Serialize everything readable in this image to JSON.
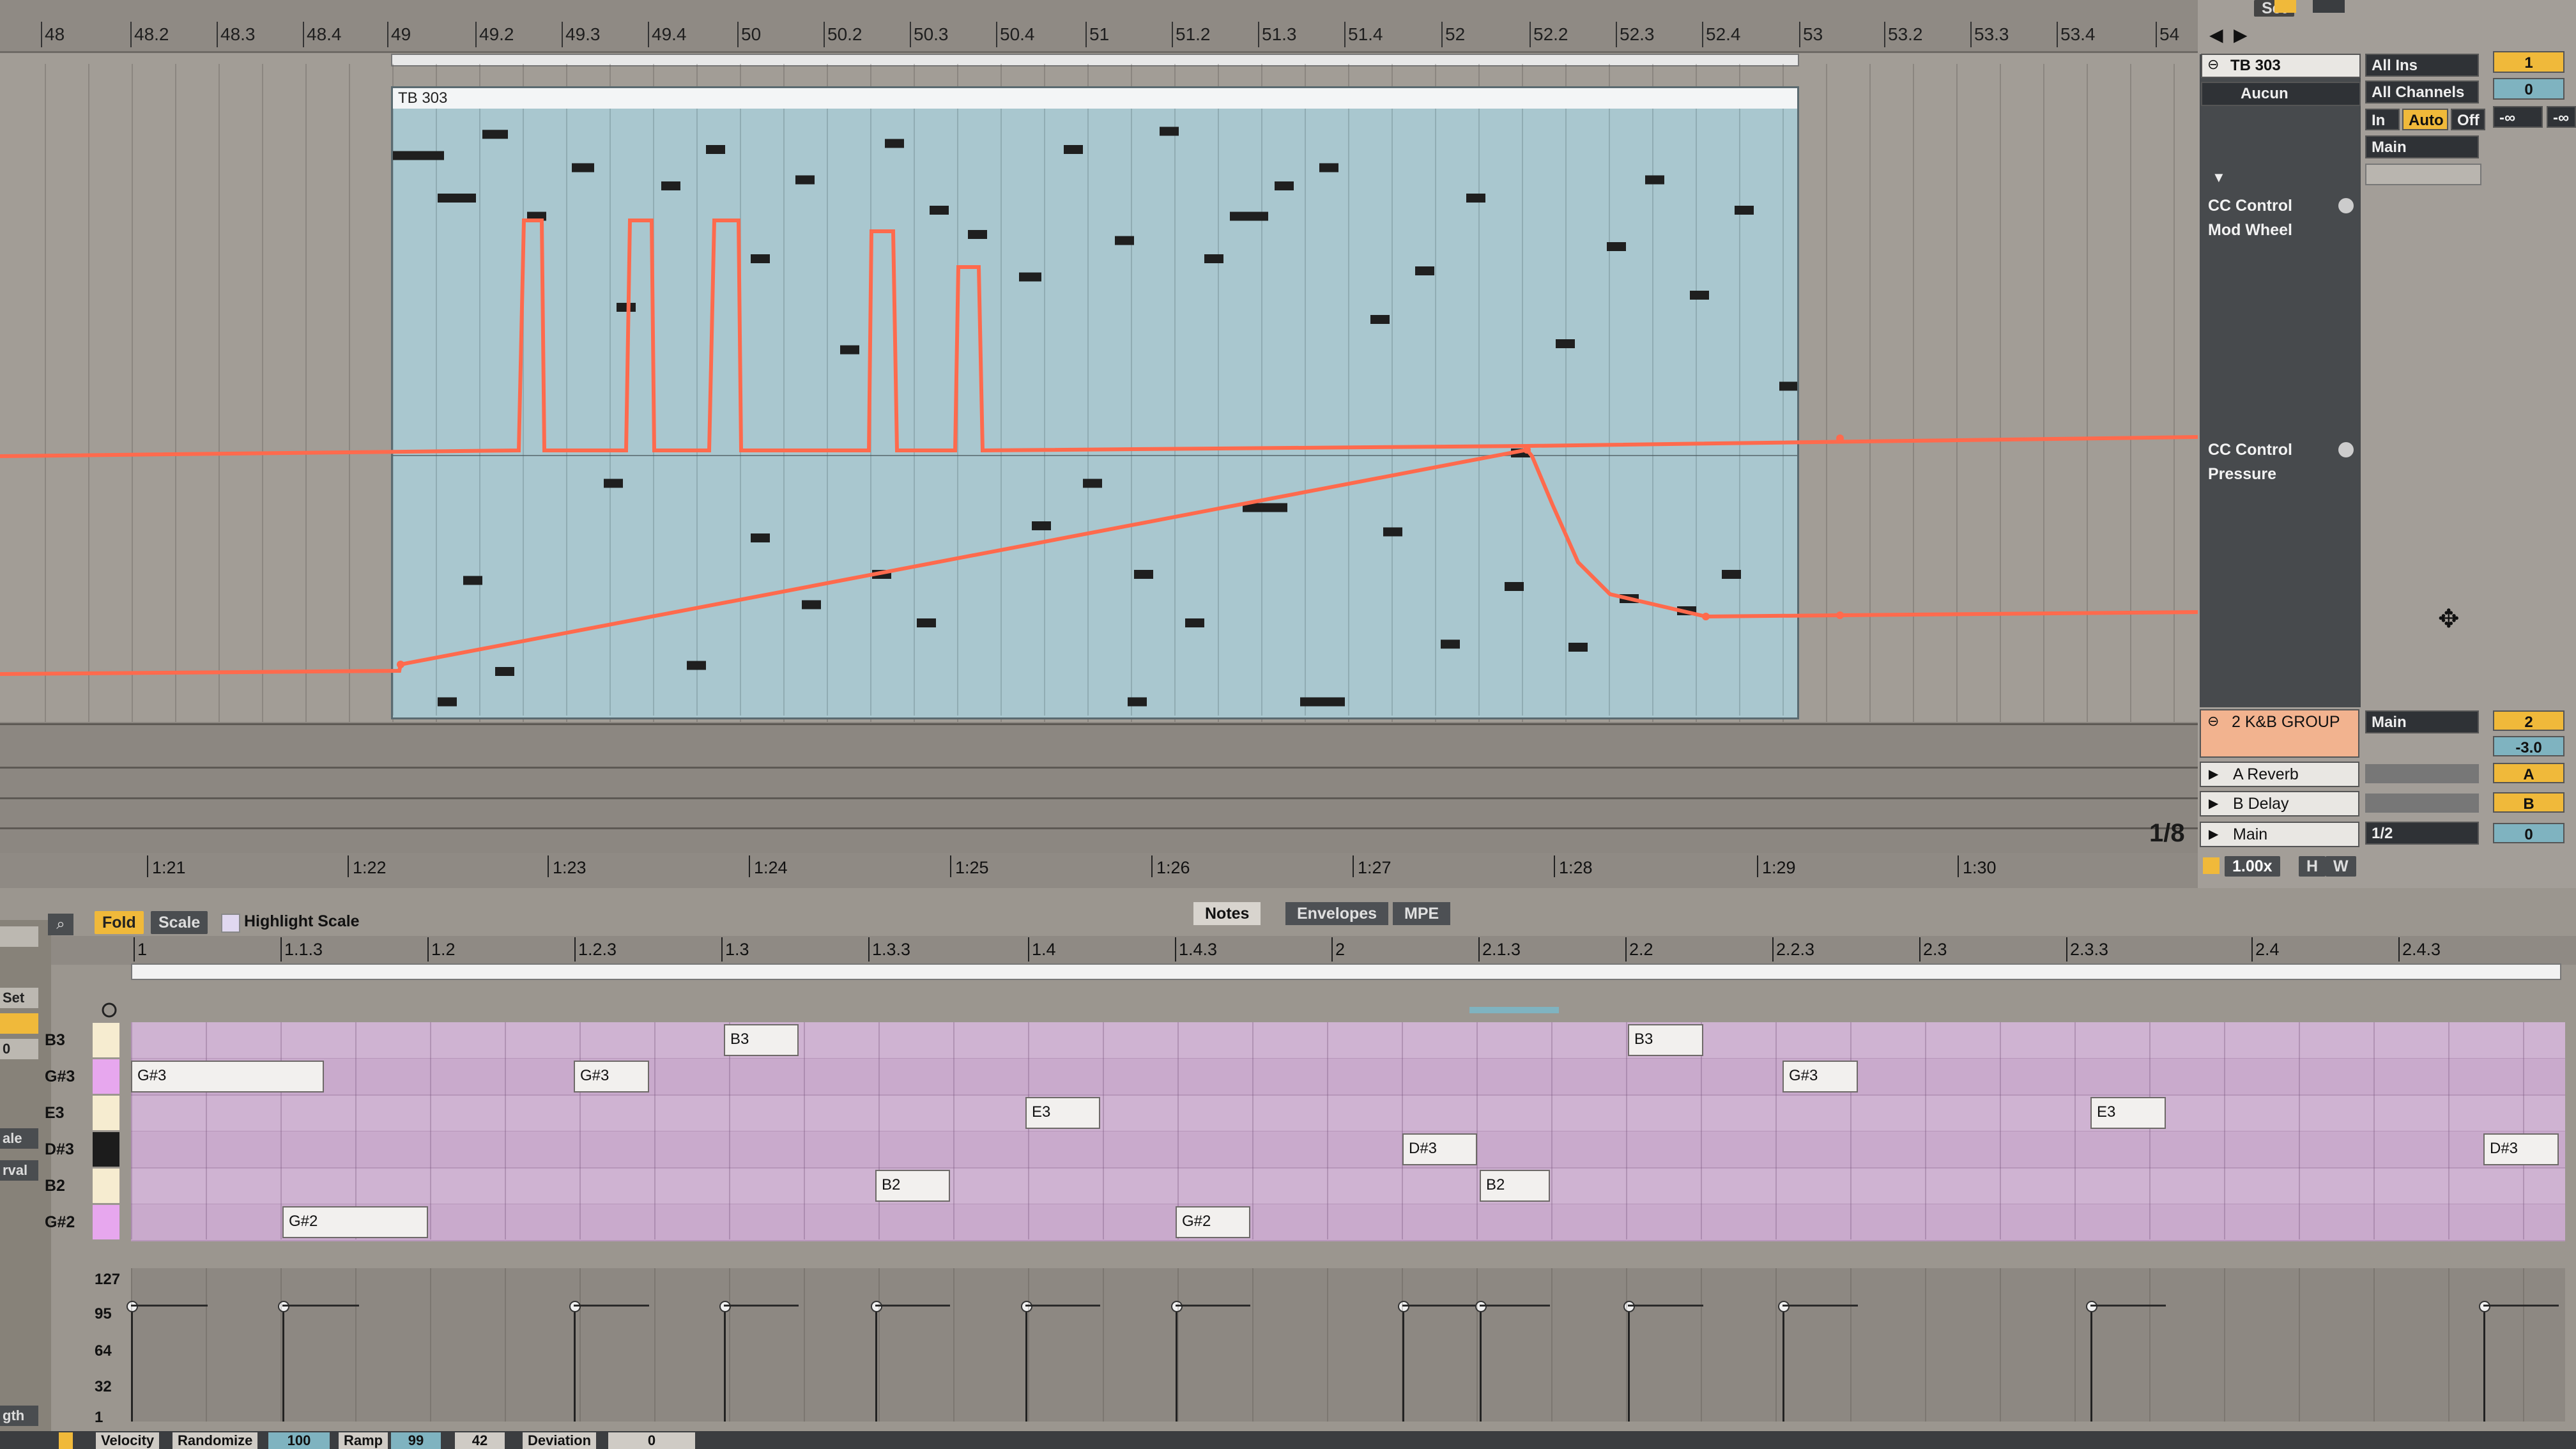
{
  "arrangement": {
    "bar_ruler": [
      "48",
      "48.2",
      "48.3",
      "48.4",
      "49",
      "49.2",
      "49.3",
      "49.4",
      "50",
      "50.2",
      "50.3",
      "50.4",
      "51",
      "51.2",
      "51.3",
      "51.4",
      "52",
      "52.2",
      "52.3",
      "52.4",
      "53",
      "53.2",
      "53.3",
      "53.4",
      "54"
    ],
    "time_ruler": [
      "1:21",
      "1:22",
      "1:23",
      "1:24",
      "1:25",
      "1:26",
      "1:27",
      "1:28",
      "1:29",
      "1:30"
    ],
    "clip_name": "TB 303",
    "grid_quant": "1/8"
  },
  "mixer": {
    "set_label": "Set",
    "track_name": "TB 303",
    "preset": "Aucun",
    "input_type": "All Ins",
    "input_channel": "All Channels",
    "monitor": [
      "In",
      "Auto",
      "Off"
    ],
    "output": "Main",
    "track_number": "1",
    "volume_db": "0",
    "pan_inf": "-∞",
    "cc1_label": "CC Control",
    "cc1_param": "Mod Wheel",
    "cc2_label": "CC Control",
    "cc2_param": "Pressure",
    "group_name": "2 K&B GROUP",
    "group_output": "Main",
    "group_number": "2",
    "group_volume": "-3.0",
    "return_a": "A Reverb",
    "return_b": "B Delay",
    "master": "Main",
    "send_a": "A",
    "send_b": "B",
    "master_val": "0",
    "master_quant": "1/2",
    "tempo_scale": "1.00x",
    "h_btn": "H",
    "w_btn": "W"
  },
  "editor": {
    "fold": "Fold",
    "scale": "Scale",
    "highlight_scale": "Highlight Scale",
    "tabs": [
      "Notes",
      "Envelopes",
      "MPE"
    ],
    "ruler": [
      "1",
      "1.1.3",
      "1.2",
      "1.2.3",
      "1.3",
      "1.3.3",
      "1.4",
      "1.4.3",
      "2",
      "2.1.3",
      "2.2",
      "2.2.3",
      "2.3",
      "2.3.3",
      "2.4",
      "2.4.3"
    ],
    "rows": [
      "B3",
      "G#3",
      "E3",
      "D#3",
      "B2",
      "G#2"
    ],
    "notes": [
      {
        "label": "G#3"
      },
      {
        "label": "G#2"
      },
      {
        "label": "G#3"
      },
      {
        "label": "B3"
      },
      {
        "label": "B2"
      },
      {
        "label": "E3"
      },
      {
        "label": "G#2"
      },
      {
        "label": "D#3"
      },
      {
        "label": "B2"
      },
      {
        "label": "B3"
      },
      {
        "label": "G#3"
      },
      {
        "label": "E3"
      },
      {
        "label": "D#3"
      }
    ],
    "velocity_scale": [
      "127",
      "95",
      "64",
      "32",
      "1"
    ],
    "bottom": {
      "velocity": "Velocity",
      "randomize": "Randomize",
      "velocity_value": "100",
      "ramp": "Ramp",
      "ramp_value": "99",
      "ramp_value2": "42",
      "deviation": "Deviation",
      "deviation_value": "0"
    },
    "left_strip": [
      "Set",
      "0",
      "ale",
      "rval",
      "gth"
    ]
  },
  "colors": {
    "clip_bg": "#a9c7cf",
    "automation": "#ff6a4d",
    "piano_roll": "#cfb3d2",
    "accent": "#f0b93a",
    "teal": "#7fb3c0"
  }
}
